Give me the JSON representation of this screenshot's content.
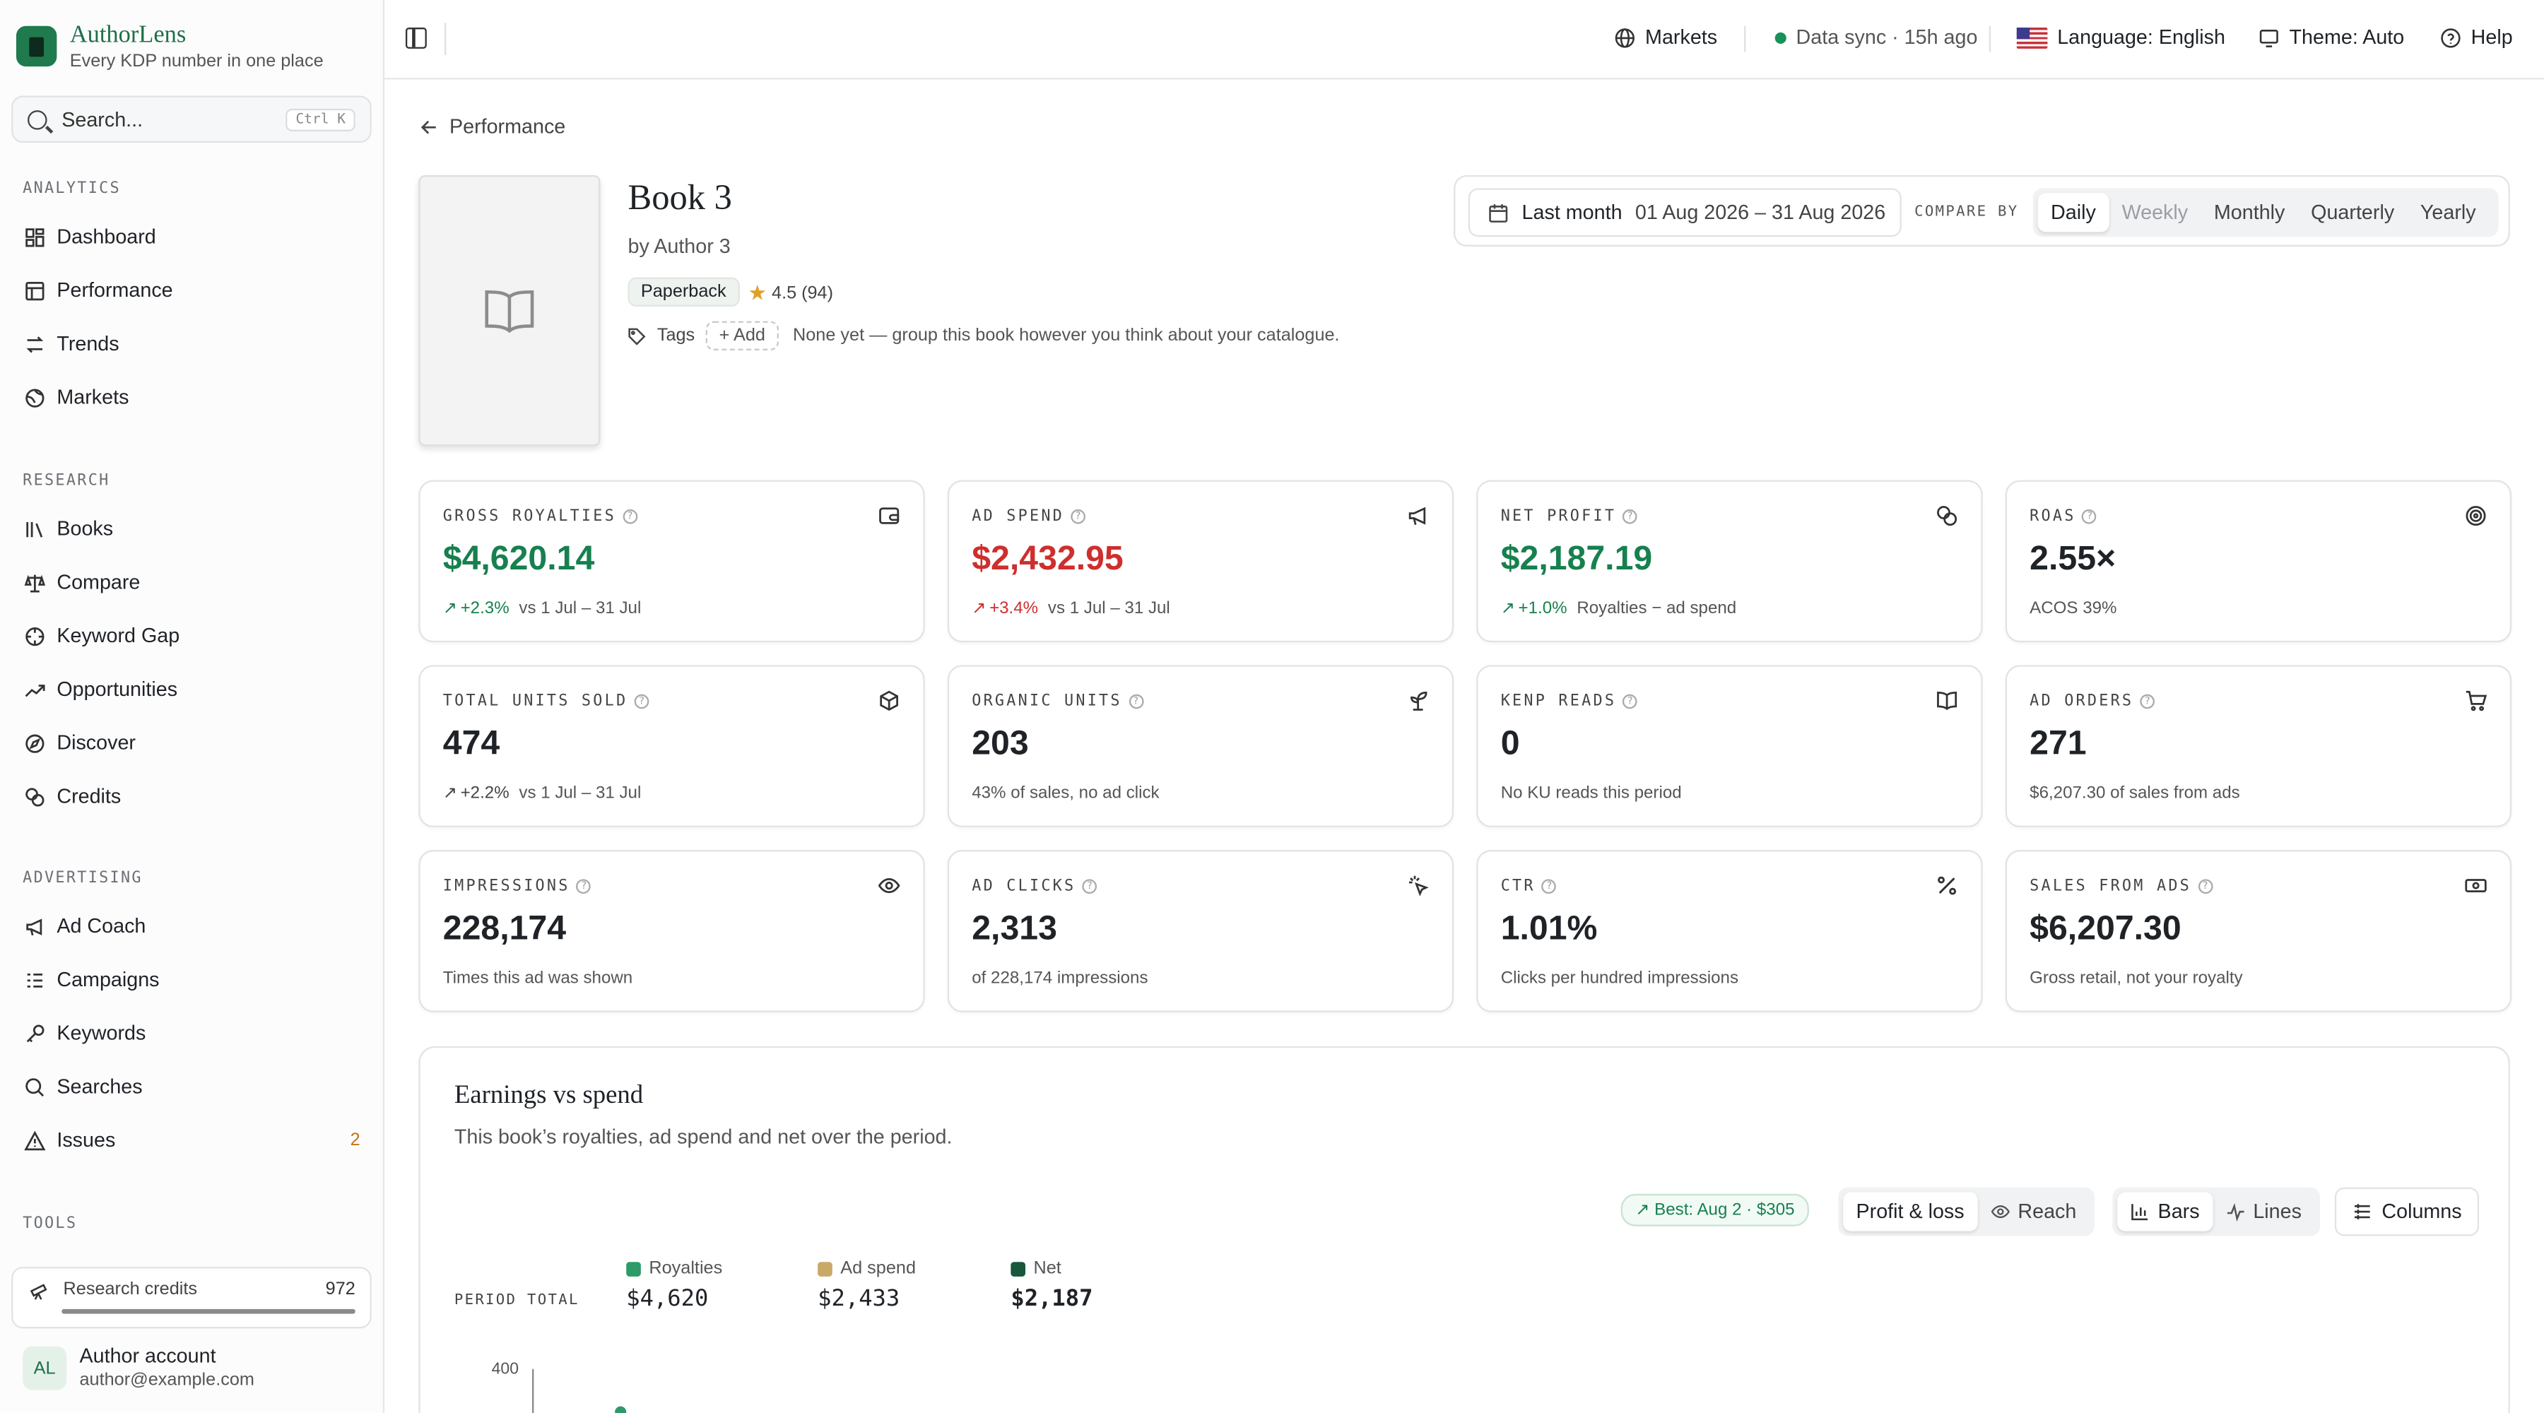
{
  "brand": {
    "name": "AuthorLens",
    "tagline": "Every KDP number in one place"
  },
  "search": {
    "placeholder": "Search...",
    "shortcut": "Ctrl K"
  },
  "nav": {
    "analytics_label": "ANALYTICS",
    "analytics": [
      {
        "label": "Dashboard",
        "icon": "dashboard-icon"
      },
      {
        "label": "Performance",
        "icon": "table-icon"
      },
      {
        "label": "Trends",
        "icon": "arrows-icon"
      },
      {
        "label": "Markets",
        "icon": "globe-icon"
      }
    ],
    "research_label": "RESEARCH",
    "research": [
      {
        "label": "Books",
        "icon": "library-icon"
      },
      {
        "label": "Compare",
        "icon": "scale-icon"
      },
      {
        "label": "Keyword Gap",
        "icon": "gap-icon"
      },
      {
        "label": "Opportunities",
        "icon": "trend-up-icon"
      },
      {
        "label": "Discover",
        "icon": "compass-icon"
      },
      {
        "label": "Credits",
        "icon": "coins-icon"
      }
    ],
    "advertising_label": "ADVERTISING",
    "advertising": [
      {
        "label": "Ad Coach",
        "icon": "megaphone-icon"
      },
      {
        "label": "Campaigns",
        "icon": "list-icon"
      },
      {
        "label": "Keywords",
        "icon": "key-icon"
      },
      {
        "label": "Searches",
        "icon": "search-icon"
      },
      {
        "label": "Issues",
        "icon": "warning-icon",
        "badge": "2"
      }
    ],
    "tools_label": "TOOLS"
  },
  "credits": {
    "label": "Research credits",
    "value": "972",
    "fill_fraction": 1.0
  },
  "account": {
    "initials": "AL",
    "name": "Author account",
    "email": "author@example.com"
  },
  "topbar": {
    "markets": "Markets",
    "sync": "Data sync · 15h ago",
    "language": "Language: English",
    "theme": "Theme: Auto",
    "help": "Help"
  },
  "back_label": "Performance",
  "book": {
    "title": "Book 3",
    "author": "by Author 3",
    "format": "Paperback",
    "rating": "4.5",
    "rating_count": "(94)",
    "tags_label": "Tags",
    "add_tag": "+ Add",
    "tags_note": "None yet — group this book however you think about your catalogue."
  },
  "date": {
    "preset": "Last month",
    "range": "01 Aug 2026 – 31 Aug 2026",
    "compare_label": "COMPARE BY",
    "options": [
      "Daily",
      "Weekly",
      "Monthly",
      "Quarterly",
      "Yearly"
    ],
    "selected": "Daily",
    "disabled": [
      "Weekly"
    ]
  },
  "metrics": [
    {
      "label": "GROSS ROYALTIES",
      "value": "$4,620.14",
      "tone": "green",
      "delta": "+2.3%",
      "delta_tone": "green",
      "sub": "vs 1 Jul – 31 Jul",
      "icon": "wallet-icon"
    },
    {
      "label": "AD SPEND",
      "value": "$2,432.95",
      "tone": "red",
      "delta": "+3.4%",
      "delta_tone": "red",
      "sub": "vs 1 Jul – 31 Jul",
      "icon": "megaphone-icon"
    },
    {
      "label": "NET PROFIT",
      "value": "$2,187.19",
      "tone": "green",
      "delta": "+1.0%",
      "delta_tone": "green",
      "sub": "Royalties − ad spend",
      "icon": "coins-icon"
    },
    {
      "label": "ROAS",
      "value": "2.55×",
      "tone": "",
      "delta": "",
      "delta_tone": "",
      "sub": "ACOS 39%",
      "icon": "target-icon"
    },
    {
      "label": "TOTAL UNITS SOLD",
      "value": "474",
      "tone": "",
      "delta": "+2.2%",
      "delta_tone": "",
      "sub": "vs 1 Jul – 31 Jul",
      "icon": "package-icon"
    },
    {
      "label": "ORGANIC UNITS",
      "value": "203",
      "tone": "",
      "delta": "",
      "delta_tone": "",
      "sub": "43% of sales, no ad click",
      "icon": "sprout-icon"
    },
    {
      "label": "KENP READS",
      "value": "0",
      "tone": "",
      "delta": "",
      "delta_tone": "",
      "sub": "No KU reads this period",
      "icon": "book-open-icon"
    },
    {
      "label": "AD ORDERS",
      "value": "271",
      "tone": "",
      "delta": "",
      "delta_tone": "",
      "sub": "$6,207.30 of sales from ads",
      "icon": "cart-icon"
    },
    {
      "label": "IMPRESSIONS",
      "value": "228,174",
      "tone": "",
      "delta": "",
      "delta_tone": "",
      "sub": "Times this ad was shown",
      "icon": "eye-icon"
    },
    {
      "label": "AD CLICKS",
      "value": "2,313",
      "tone": "",
      "delta": "",
      "delta_tone": "",
      "sub": "of 228,174 impressions",
      "icon": "click-icon"
    },
    {
      "label": "CTR",
      "value": "1.01%",
      "tone": "",
      "delta": "",
      "delta_tone": "",
      "sub": "Clicks per hundred impressions",
      "icon": "percent-icon"
    },
    {
      "label": "SALES FROM ADS",
      "value": "$6,207.30",
      "tone": "",
      "delta": "",
      "delta_tone": "",
      "sub": "Gross retail, not your royalty",
      "icon": "banknote-icon"
    }
  ],
  "chart": {
    "title": "Earnings vs spend",
    "description": "This book’s royalties, ad spend and net over the period.",
    "best": "Best: Aug 2 · $305",
    "view_options": [
      "Profit & loss",
      "Reach"
    ],
    "view_selected": "Profit & loss",
    "style_options": [
      "Bars",
      "Lines"
    ],
    "style_selected": "Bars",
    "columns_label": "Columns",
    "period_label": "PERIOD TOTAL",
    "colors": {
      "royalties": "#2e9a68",
      "ad_spend": "#c9a968",
      "net": "#17573a"
    }
  },
  "chart_data": {
    "type": "bar",
    "title": "Earnings vs spend",
    "series": [
      {
        "name": "Royalties",
        "total": "$4,620"
      },
      {
        "name": "Ad spend",
        "total": "$2,433"
      },
      {
        "name": "Net",
        "total": "$2,187"
      }
    ],
    "y_ticks": [
      "400"
    ]
  }
}
